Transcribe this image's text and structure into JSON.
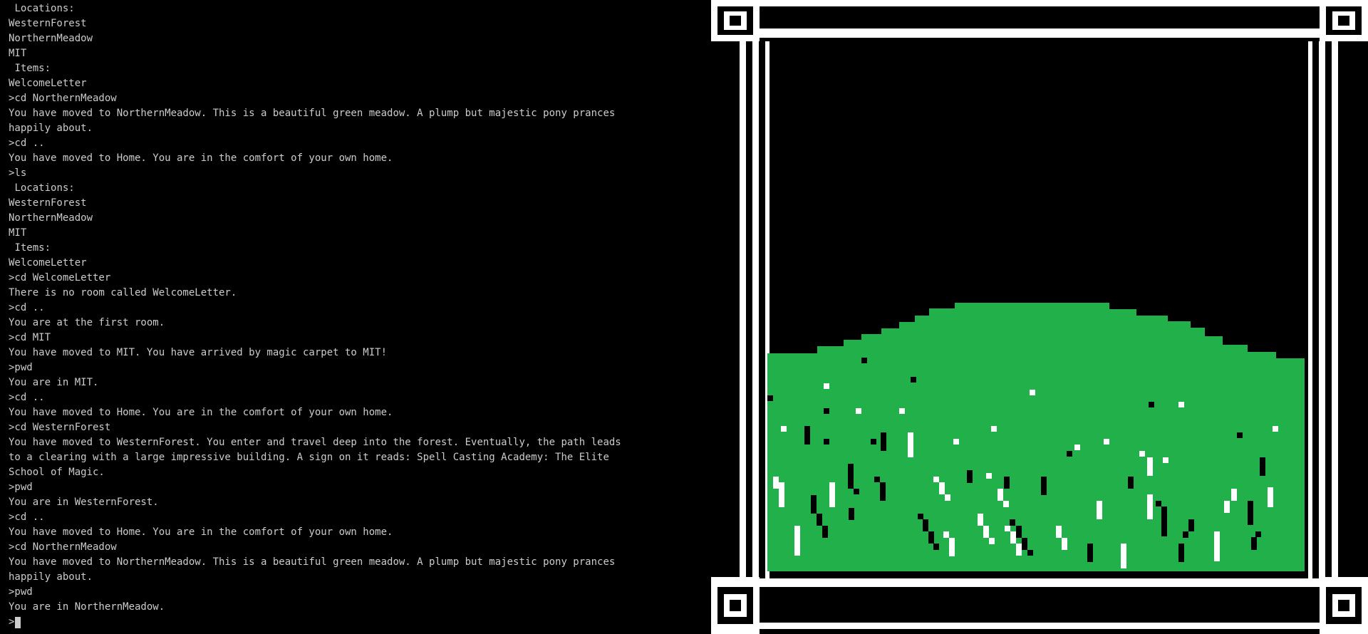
{
  "terminal": {
    "lines": [
      ">cd ..",
      "You have moved to Home. You are in the comfort of your own home.",
      ">ls",
      " Locations:",
      "WesternForest",
      "NorthernMeadow",
      "MIT",
      " Items:",
      "WelcomeLetter",
      ">cd NorthernMeadow",
      "You have moved to NorthernMeadow. This is a beautiful green meadow. A plump but majestic pony prances happily about.",
      ">cd ..",
      "You have moved to Home. You are in the comfort of your own home.",
      ">ls",
      " Locations:",
      "WesternForest",
      "NorthernMeadow",
      "MIT",
      " Items:",
      "WelcomeLetter",
      ">cd WelcomeLetter",
      "There is no room called WelcomeLetter.",
      ">cd ..",
      "You are at the first room.",
      ">cd MIT",
      "You have moved to MIT. You have arrived by magic carpet to MIT!",
      ">pwd",
      "You are in MIT.",
      ">cd ..",
      "You have moved to Home. You are in the comfort of your own home.",
      ">cd WesternForest",
      "You have moved to WesternForest. You enter and travel deep into the forest. Eventually, the path leads to a clearing with a large impressive building. A sign on it reads: Spell Casting Academy: The Elite School of Magic.",
      ">pwd",
      "You are in WesternForest.",
      ">cd ..",
      "You have moved to Home. You are in the comfort of your own home.",
      ">cd NorthernMeadow",
      "You have moved to NorthernMeadow. This is a beautiful green meadow. A plump but majestic pony prances happily about.",
      ">pwd",
      "You are in NorthernMeadow."
    ],
    "prompt": ">"
  },
  "scene": {
    "location_art": "northern-meadow-hill",
    "colors": {
      "background": "#000000",
      "frame": "#ffffff",
      "grass": "#22b04b",
      "speck_dark": "#000000",
      "speck_light": "#ffffff"
    }
  }
}
